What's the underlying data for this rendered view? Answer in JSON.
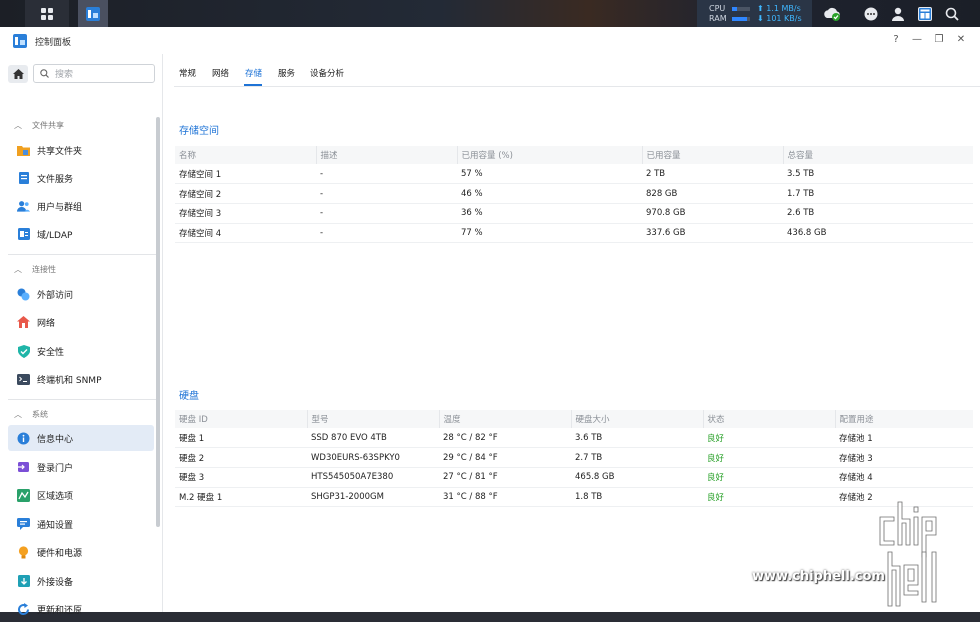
{
  "taskbar": {
    "cpu_label": "CPU",
    "ram_label": "RAM",
    "cpu_fill": 0.25,
    "ram_fill": 0.85,
    "upload": "⬆ 1.1 MB/s",
    "download": "⬇ 101 KB/s"
  },
  "window": {
    "title": "控制面板",
    "help": "?",
    "minimize": "—",
    "restore": "❐",
    "close": "✕"
  },
  "search": {
    "placeholder": "搜索"
  },
  "sidebar": {
    "sections": [
      {
        "label": "文件共享",
        "items": [
          "共享文件夹",
          "文件服务",
          "用户与群组",
          "域/LDAP"
        ]
      },
      {
        "label": "连接性",
        "items": [
          "外部访问",
          "网络",
          "安全性",
          "终端机和 SNMP"
        ]
      },
      {
        "label": "系统",
        "items": [
          "信息中心",
          "登录门户",
          "区域选项",
          "通知设置",
          "硬件和电源",
          "外接设备",
          "更新和还原"
        ]
      }
    ]
  },
  "tabs": [
    "常规",
    "网络",
    "存储",
    "服务",
    "设备分析"
  ],
  "active_tab": "存储",
  "storage": {
    "title": "存储空间",
    "headers": [
      "名称",
      "描述",
      "已用容量 (%)",
      "已用容量",
      "总容量"
    ],
    "rows": [
      [
        "存储空间 1",
        "-",
        "57 %",
        "2 TB",
        "3.5 TB"
      ],
      [
        "存储空间 2",
        "-",
        "46 %",
        "828 GB",
        "1.7 TB"
      ],
      [
        "存储空间 3",
        "-",
        "36 %",
        "970.8 GB",
        "2.6 TB"
      ],
      [
        "存储空间 4",
        "-",
        "77 %",
        "337.6 GB",
        "436.8 GB"
      ]
    ]
  },
  "disks": {
    "title": "硬盘",
    "headers": [
      "硬盘 ID",
      "型号",
      "温度",
      "硬盘大小",
      "状态",
      "配置用途"
    ],
    "rows": [
      [
        "硬盘 1",
        "SSD 870 EVO 4TB",
        "28 °C / 82 °F",
        "3.6 TB",
        "良好",
        "存储池 1"
      ],
      [
        "硬盘 2",
        "WD30EURS-63SPKY0",
        "29 °C / 84 °F",
        "2.7 TB",
        "良好",
        "存储池 3"
      ],
      [
        "硬盘 3",
        "HTS545050A7E380",
        "27 °C / 81 °F",
        "465.8 GB",
        "良好",
        "存储池 4"
      ],
      [
        "M.2 硬盘 1",
        "SHGP31-2000GM",
        "31 °C / 88 °F",
        "1.8 TB",
        "良好",
        "存储池 2"
      ]
    ],
    "good_color": "#2aa12a"
  },
  "watermark": {
    "url": "www.chiphell.com",
    "logo_text": "chip hell"
  },
  "accent_color": "#1e73d6"
}
